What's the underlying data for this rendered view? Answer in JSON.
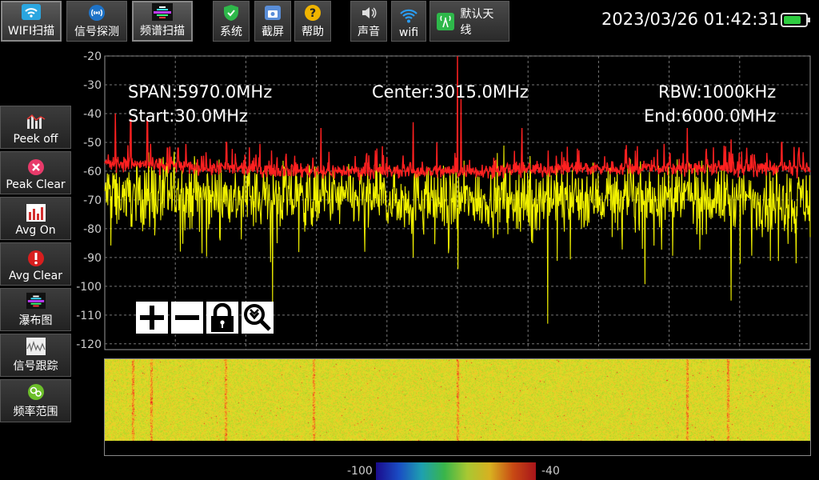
{
  "toolbar": {
    "wifi_scan": "WIFI扫描",
    "signal_detect": "信号探测",
    "spectrum_scan": "频谱扫描",
    "system": "系统",
    "screenshot": "截屏",
    "help": "帮助",
    "sound": "声音",
    "wifi": "wifi",
    "default_antenna": "默认天线"
  },
  "status": {
    "datetime": "2023/03/26 01:42:31",
    "battery_level": 0.8,
    "battery_color": "#2ecc40"
  },
  "sidebar": {
    "items": [
      {
        "label": "Peek off",
        "icon": "bar-graph-icon"
      },
      {
        "label": "Peak Clear",
        "icon": "close-circle-icon"
      },
      {
        "label": "Avg On",
        "icon": "bar-chart-icon"
      },
      {
        "label": "Avg Clear",
        "icon": "alert-icon"
      },
      {
        "label": "瀑布图",
        "icon": "spectrum-icon"
      },
      {
        "label": "信号跟踪",
        "icon": "waveform-icon"
      },
      {
        "label": "频率范围",
        "icon": "gear-icon"
      }
    ]
  },
  "info": {
    "span": "SPAN:5970.0MHz",
    "center": "Center:3015.0MHz",
    "rbw": "RBW:1000kHz",
    "start": "Start:30.0MHz",
    "end": "End:6000.0MHz"
  },
  "tools": [
    "zoom-in-icon",
    "zoom-out-icon",
    "lock-icon",
    "zoom-reset-icon"
  ],
  "colorbar": {
    "min_label": "-100",
    "max_label": "-40"
  },
  "chart_data": {
    "type": "line",
    "x_unit": "MHz",
    "xlim": [
      30,
      6000
    ],
    "ylim": [
      -122,
      -20
    ],
    "yticks": [
      -20,
      -30,
      -40,
      -50,
      -60,
      -70,
      -80,
      -90,
      -100,
      -110,
      -120
    ],
    "grid": true,
    "series": [
      {
        "color": "#ff2020",
        "baseline_values": [
          [
            30,
            -57
          ],
          [
            500,
            -58
          ],
          [
            1000,
            -59
          ],
          [
            2000,
            -60
          ],
          [
            3015,
            -60
          ],
          [
            4000,
            -59
          ],
          [
            5000,
            -59
          ],
          [
            6000,
            -59
          ]
        ],
        "peaks": [
          [
            120,
            -40
          ],
          [
            250,
            -42
          ],
          [
            390,
            -42
          ],
          [
            560,
            -52
          ],
          [
            650,
            -52
          ],
          [
            1060,
            -50
          ],
          [
            1860,
            -45
          ],
          [
            2640,
            -43
          ],
          [
            2840,
            -50
          ],
          [
            3015,
            -20
          ],
          [
            3015,
            -25
          ],
          [
            3045,
            -35
          ],
          [
            3560,
            -45
          ],
          [
            4960,
            -45
          ],
          [
            5330,
            -49
          ],
          [
            5760,
            -50
          ]
        ]
      },
      {
        "color": "#f0f000",
        "baseline_values": [
          [
            30,
            -68
          ],
          [
            1500,
            -69
          ],
          [
            3000,
            -70
          ],
          [
            4500,
            -69
          ],
          [
            6000,
            -70
          ]
        ],
        "dips": [
          [
            1450,
            -106
          ],
          [
            2230,
            -88
          ],
          [
            2640,
            -90
          ],
          [
            3020,
            -94
          ],
          [
            3780,
            -113
          ],
          [
            4580,
            -87
          ],
          [
            5330,
            -105
          ],
          [
            5880,
            -92
          ]
        ]
      }
    ],
    "waterfall": {
      "range_db": [
        -100,
        -40
      ],
      "bright_lines_mhz": [
        270,
        420,
        1050,
        1800,
        3015,
        4960,
        5300
      ]
    }
  }
}
